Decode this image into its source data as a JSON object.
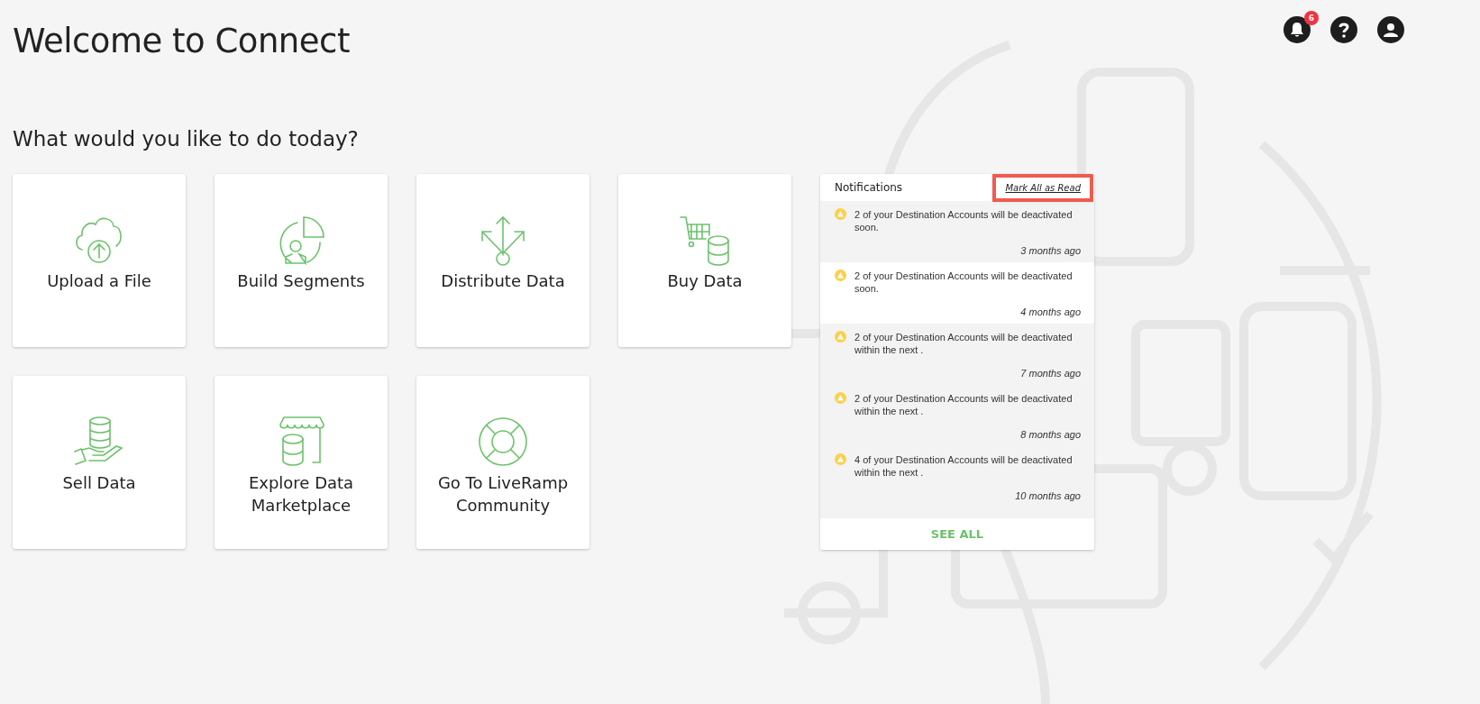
{
  "header": {
    "title": "Welcome to Connect",
    "notification_count": "6"
  },
  "prompt": "What would you like to do today?",
  "tiles": [
    {
      "label": "Upload a File",
      "kind": "upload"
    },
    {
      "label": "Build Segments",
      "kind": "segments"
    },
    {
      "label": "Distribute Data",
      "kind": "distribute"
    },
    {
      "label": "Buy Data",
      "kind": "buy"
    },
    {
      "label": "Sell Data",
      "kind": "sell"
    },
    {
      "label": "Explore Data Marketplace",
      "kind": "marketplace"
    },
    {
      "label": "Go To LiveRamp Community",
      "kind": "community"
    }
  ],
  "notifications": {
    "title": "Notifications",
    "mark_all": "Mark All as Read",
    "mark_all_highlighted": true,
    "items": [
      {
        "text": "2 of your Destination Accounts will be deactivated soon.",
        "time": "3 months ago",
        "read": false
      },
      {
        "text": "2 of your Destination Accounts will be deactivated soon.",
        "time": "4 months ago",
        "read": true
      },
      {
        "text": "2 of your Destination Accounts will be deactivated within the next .",
        "time": "7 months ago",
        "read": false
      },
      {
        "text": "2 of your Destination Accounts will be deactivated within the next .",
        "time": "8 months ago",
        "read": false
      },
      {
        "text": "4 of your Destination Accounts will be deactivated within the next .",
        "time": "10 months ago",
        "read": false
      }
    ],
    "see_all": "SEE ALL"
  }
}
